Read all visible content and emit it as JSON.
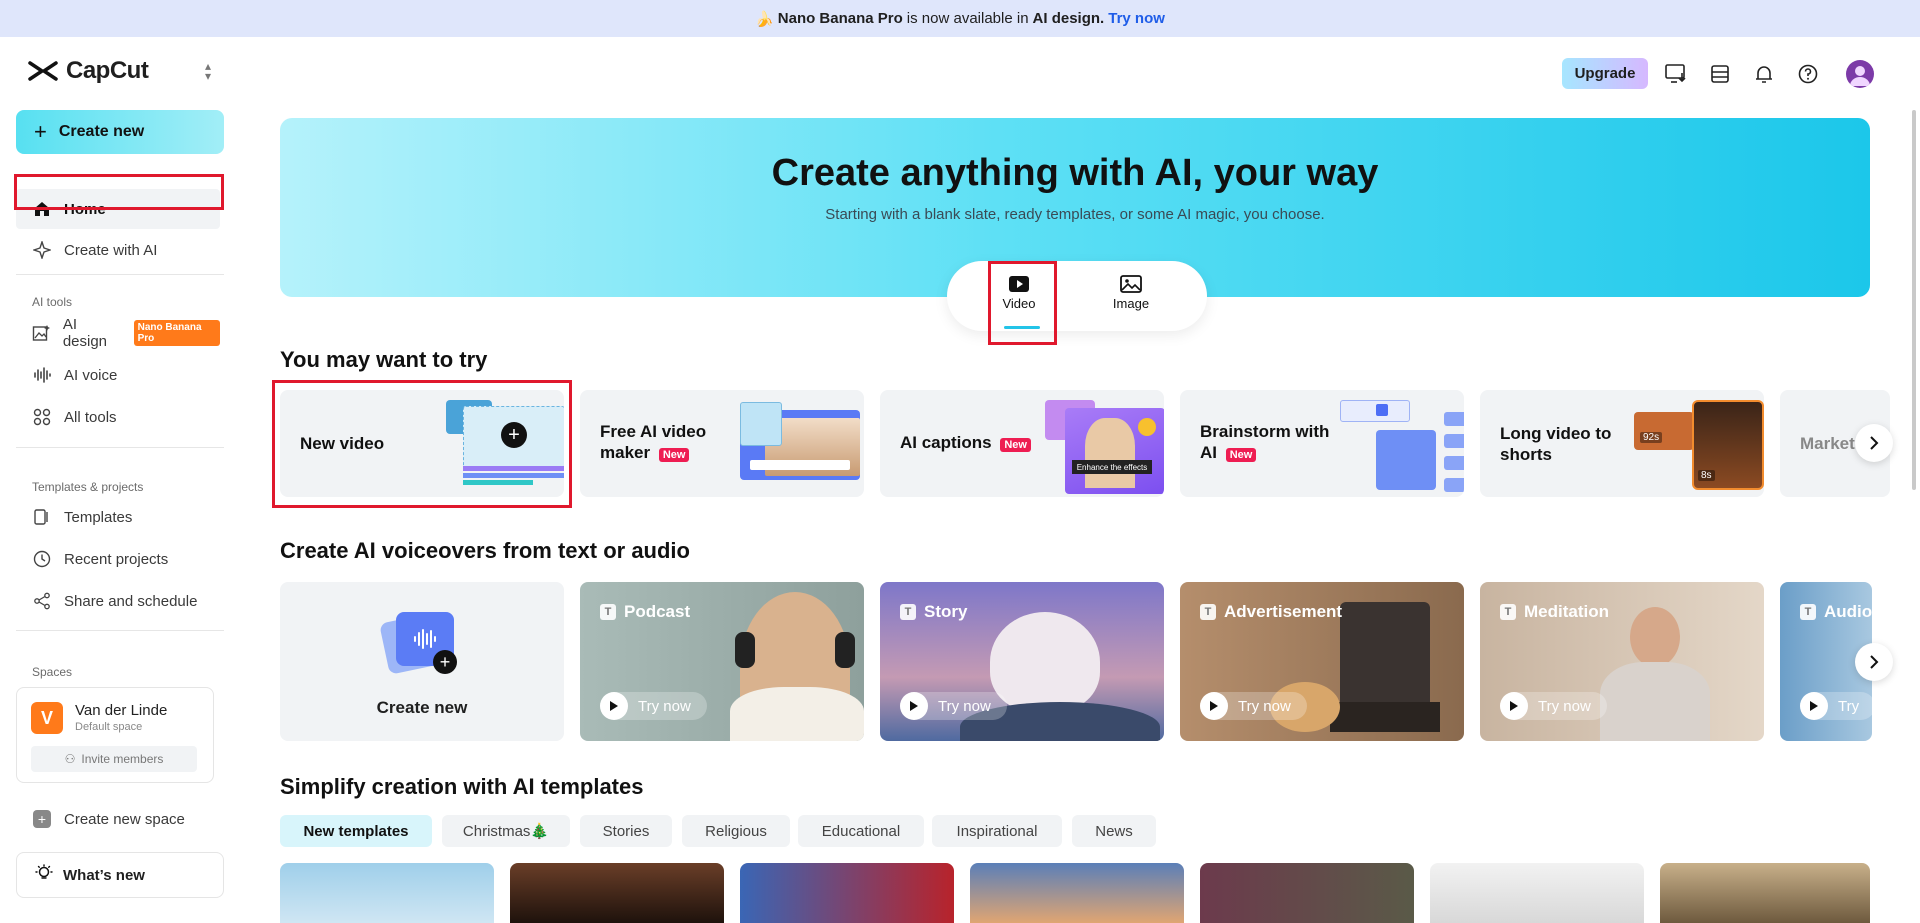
{
  "banner": {
    "emoji": "🍌",
    "product": "Nano Banana Pro",
    "middle": "is now available in",
    "feature": "AI design.",
    "cta": "Try now"
  },
  "app": {
    "name": "CapCut"
  },
  "sidebar": {
    "create_new": "Create new",
    "items": [
      {
        "label": "Home",
        "icon": "home-icon"
      },
      {
        "label": "Create with AI",
        "icon": "sparkle-icon"
      }
    ],
    "ai_tools_label": "AI tools",
    "ai_tools": [
      {
        "label": "AI design",
        "badge": "Nano Banana Pro",
        "icon": "image-sparkle-icon"
      },
      {
        "label": "AI voice",
        "icon": "waveform-icon"
      },
      {
        "label": "All tools",
        "icon": "grid-icon"
      }
    ],
    "templates_label": "Templates & projects",
    "templates": [
      {
        "label": "Templates",
        "icon": "template-icon"
      },
      {
        "label": "Recent projects",
        "icon": "clock-icon"
      },
      {
        "label": "Share and schedule",
        "icon": "share-icon"
      }
    ],
    "spaces_label": "Spaces",
    "space": {
      "initial": "V",
      "name": "Van der Linde",
      "sub": "Default space",
      "invite": "Invite members"
    },
    "create_space": "Create new space",
    "whats_new": "What’s new"
  },
  "header": {
    "upgrade": "Upgrade"
  },
  "hero": {
    "title": "Create anything with AI, your way",
    "subtitle": "Starting with a blank slate, ready templates, or some AI magic, you choose.",
    "modes": [
      "Video",
      "Image"
    ]
  },
  "try_section": {
    "title": "You may want to try",
    "cards": [
      {
        "label": "New video",
        "new": ""
      },
      {
        "label": "Free AI video maker",
        "new": "New"
      },
      {
        "label": "AI captions",
        "new": "New"
      },
      {
        "label": "Brainstorm with AI",
        "new": "New"
      },
      {
        "label": "Long video to shorts",
        "new": ""
      },
      {
        "label": "Market video a",
        "new": ""
      }
    ],
    "thumb_labels": {
      "ae": "Enhance the effects",
      "t1": "92s",
      "t2": "8s"
    }
  },
  "voice_section": {
    "title": "Create AI voiceovers from text or audio",
    "create_new": "Create new",
    "cards": [
      {
        "label": "Podcast",
        "try": "Try now"
      },
      {
        "label": "Story",
        "try": "Try now"
      },
      {
        "label": "Advertisement",
        "try": "Try now"
      },
      {
        "label": "Meditation",
        "try": "Try now"
      },
      {
        "label": "Audio",
        "try": "Try"
      }
    ]
  },
  "templates_section": {
    "title": "Simplify creation with AI templates",
    "chips": [
      "New templates",
      "Christmas🎄",
      "Stories",
      "Religious",
      "Educational",
      "Inspirational",
      "News"
    ]
  },
  "colors": {
    "accent": "#23c4e8",
    "highlight": "#e0182d",
    "new_tag": "#ee1d52",
    "orange": "#ff7a1a"
  }
}
